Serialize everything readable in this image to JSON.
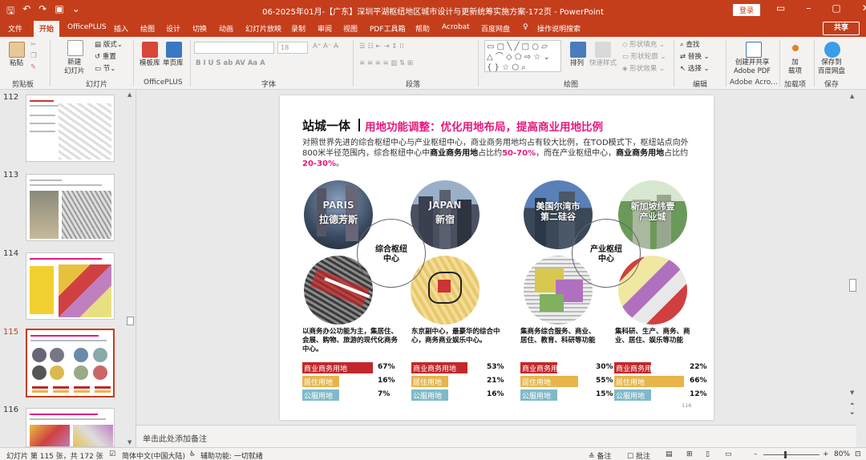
{
  "titlebar": {
    "title": "06-2025年01月-【广东】深圳平湖枢纽地区城市设计与更新统筹实施方案-172页  -  PowerPoint",
    "login": "登录"
  },
  "menu": {
    "items": [
      "文件",
      "开始",
      "OfficePLUS",
      "插入",
      "绘图",
      "设计",
      "切换",
      "动画",
      "幻灯片放映",
      "录制",
      "审阅",
      "视图",
      "PDF工具箱",
      "帮助",
      "Acrobat",
      "百度网盘",
      "操作说明搜索"
    ],
    "share": "共享"
  },
  "ribbon": {
    "groups": [
      "剪贴板",
      "幻灯片",
      "OfficePLUS",
      "字体",
      "段落",
      "绘图",
      "编辑",
      "Adobe Acro...",
      "加载项",
      "保存"
    ],
    "paste": "粘贴",
    "new_slide": "新建\n幻灯片",
    "layout": "版式",
    "reset": "重置",
    "section": "节",
    "template_lib": "模板库",
    "single_page_lib": "单页库",
    "font_size": "18",
    "arrange": "排列",
    "quick_style": "快速样式",
    "shape_fill": "形状填充",
    "shape_outline": "形状轮廓",
    "shape_effect": "形状效果",
    "find": "查找",
    "replace": "替换",
    "select": "选择",
    "create_share_pdf": "创建并共享\nAdobe PDF",
    "addins": "加\n载项",
    "save_baidu": "保存到\n百度网盘"
  },
  "slides": {
    "numbers": [
      "112",
      "113",
      "114",
      "115",
      "116"
    ],
    "selected": "115"
  },
  "slide": {
    "title_main": "站城一体",
    "title_sub": "用地功能调整：优化用地布局，提高商业用地比例",
    "body": {
      "p1": "对照世界先进的综合枢纽中心与产业枢纽中心，商业商务用地均占有较大比例，在TOD模式下，枢纽站点向外800米半径范围内，综合枢纽中心中",
      "b1": "商业商务用地",
      "p2": "占比约",
      "h1": "50-70%",
      "p3": "，而在产业枢纽中心，",
      "b2": "商业商务用地",
      "p4": "占比约",
      "h2": "20-30%",
      "p5": "。"
    },
    "hubs": {
      "left": "综合枢纽\n中心",
      "right": "产业枢纽\n中心"
    },
    "cities": [
      {
        "label_en": "PARIS",
        "label_cn": "拉德芳斯"
      },
      {
        "label_en": "JAPAN",
        "label_cn": "新宿"
      },
      {
        "label_en": "",
        "label_cn": "美国尔湾市\n第二硅谷"
      },
      {
        "label_en": "",
        "label_cn": "新加坡纬壹\n产业城"
      }
    ],
    "descriptions": [
      "以商务办公功能为主，集居住、会展、购物、旅游的现代化商务中心。",
      "东京副中心，最豪华的综合中心，商务商业娱乐中心。",
      "集商务综合服务、商业、居住、教育、科研等功能",
      "集科研、生产、商务、商业、居住、娱乐等功能"
    ],
    "land_use": [
      [
        {
          "label": "商业商务用地",
          "pct": "67%",
          "value": 67,
          "color": "#c3272b"
        },
        {
          "label": "居住用地",
          "pct": "16%",
          "value": 16,
          "color": "#e8b54a"
        },
        {
          "label": "公服用地",
          "pct": "7%",
          "value": 7,
          "color": "#7fb9c9"
        }
      ],
      [
        {
          "label": "商业商务用地",
          "pct": "53%",
          "value": 53,
          "color": "#c3272b"
        },
        {
          "label": "居住用地",
          "pct": "21%",
          "value": 21,
          "color": "#e8b54a"
        },
        {
          "label": "公服用地",
          "pct": "16%",
          "value": 16,
          "color": "#7fb9c9"
        }
      ],
      [
        {
          "label": "商业商务用地",
          "pct": "30%",
          "value": 30,
          "color": "#c3272b"
        },
        {
          "label": "居住用地",
          "pct": "55%",
          "value": 55,
          "color": "#e8b54a"
        },
        {
          "label": "公服用地",
          "pct": "15%",
          "value": 15,
          "color": "#7fb9c9"
        }
      ],
      [
        {
          "label": "商业商务用地",
          "pct": "22%",
          "value": 22,
          "color": "#c3272b"
        },
        {
          "label": "居住用地",
          "pct": "66%",
          "value": 66,
          "color": "#e8b54a"
        },
        {
          "label": "公服用地",
          "pct": "12%",
          "value": 12,
          "color": "#7fb9c9"
        }
      ]
    ],
    "page_number": "116"
  },
  "notes": {
    "placeholder": "单击此处添加备注"
  },
  "status": {
    "slide_info": "幻灯片 第 115 张，共 172 张",
    "language": "简体中文(中国大陆)",
    "accessibility": "辅助功能: 一切就绪",
    "notes_btn": "备注",
    "comments_btn": "批注",
    "zoom": "80%"
  }
}
